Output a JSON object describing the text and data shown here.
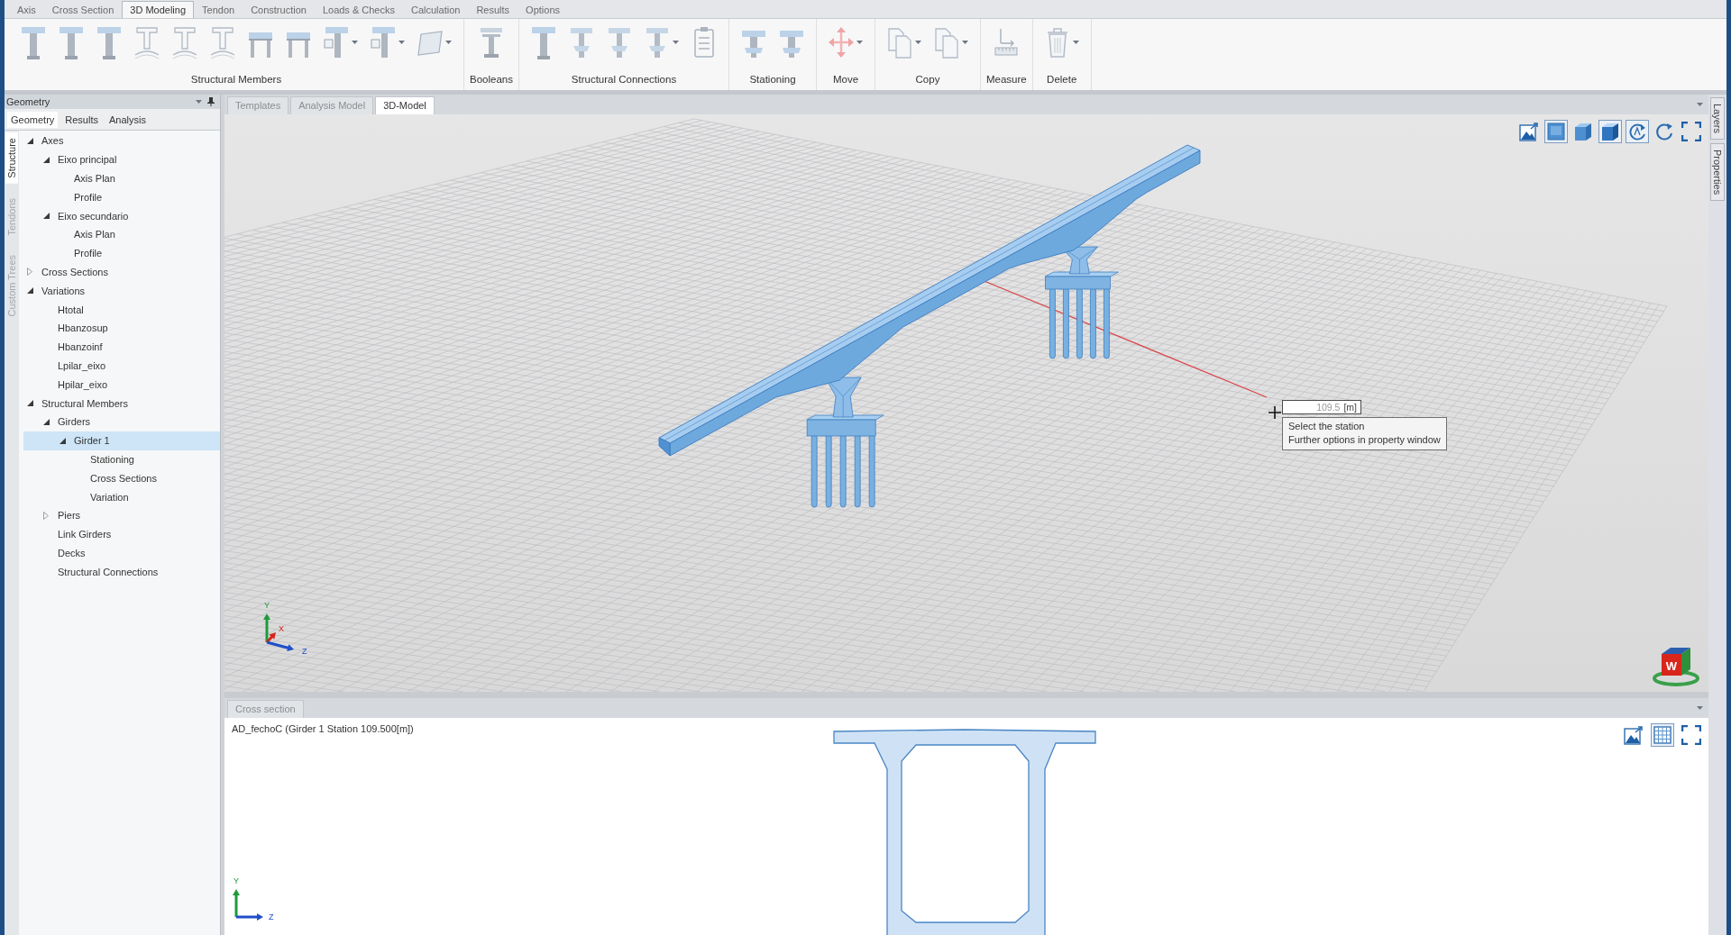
{
  "menu_tabs": [
    {
      "label": "Axis",
      "selected": false
    },
    {
      "label": "Cross Section",
      "selected": false
    },
    {
      "label": "3D Modeling",
      "selected": true
    },
    {
      "label": "Tendon",
      "selected": false
    },
    {
      "label": "Construction",
      "selected": false
    },
    {
      "label": "Loads & Checks",
      "selected": false
    },
    {
      "label": "Calculation",
      "selected": false
    },
    {
      "label": "Results",
      "selected": false
    },
    {
      "label": "Options",
      "selected": false
    }
  ],
  "ribbon": {
    "groups": [
      {
        "label": "Structural Members",
        "tools": [
          {
            "kind": "beam",
            "dropdown": false
          },
          {
            "kind": "beam",
            "dropdown": false
          },
          {
            "kind": "beam",
            "dropdown": false
          },
          {
            "kind": "curved-beam",
            "dropdown": false
          },
          {
            "kind": "curved-beam",
            "dropdown": false
          },
          {
            "kind": "curved-beam",
            "dropdown": false
          },
          {
            "kind": "frame",
            "dropdown": false
          },
          {
            "kind": "frame",
            "dropdown": false
          },
          {
            "kind": "beam-box",
            "dropdown": true
          },
          {
            "kind": "beam-box",
            "dropdown": true
          },
          {
            "kind": "plane",
            "dropdown": true
          }
        ]
      },
      {
        "label": "Booleans",
        "tools": [
          {
            "kind": "boolean",
            "dropdown": false
          }
        ]
      },
      {
        "label": "Structural Connections",
        "tools": [
          {
            "kind": "beam",
            "dropdown": false
          },
          {
            "kind": "connection",
            "dropdown": false
          },
          {
            "kind": "connection",
            "dropdown": false
          },
          {
            "kind": "connection",
            "dropdown": true
          },
          {
            "kind": "checklist",
            "dropdown": false
          }
        ]
      },
      {
        "label": "Stationing",
        "tools": [
          {
            "kind": "station",
            "dropdown": false
          },
          {
            "kind": "station",
            "dropdown": false
          }
        ]
      },
      {
        "label": "Move",
        "tools": [
          {
            "kind": "move",
            "dropdown": true
          }
        ]
      },
      {
        "label": "Copy",
        "tools": [
          {
            "kind": "copy",
            "dropdown": true
          },
          {
            "kind": "copy",
            "dropdown": true
          }
        ]
      },
      {
        "label": "Measure",
        "tools": [
          {
            "kind": "measure",
            "dropdown": false
          }
        ]
      },
      {
        "label": "Delete",
        "tools": [
          {
            "kind": "delete",
            "dropdown": true
          }
        ]
      }
    ]
  },
  "left_panel": {
    "title": "Geometry",
    "tabs": [
      {
        "label": "Geometry",
        "selected": true
      },
      {
        "label": "Results",
        "selected": false
      },
      {
        "label": "Analysis",
        "selected": false
      }
    ],
    "side_tabs": [
      {
        "label": "Structure",
        "selected": true
      },
      {
        "label": "Tendons",
        "selected": false
      },
      {
        "label": "Custom Trees",
        "selected": false
      }
    ],
    "tree": [
      {
        "label": "Axes",
        "kind": "branch",
        "expanded": true,
        "selected": false,
        "children": [
          {
            "label": "Eixo principal",
            "kind": "branch",
            "expanded": true,
            "selected": false,
            "children": [
              {
                "label": "Axis Plan",
                "kind": "leaf",
                "selected": false
              },
              {
                "label": "Profile",
                "kind": "leaf",
                "selected": false
              }
            ]
          },
          {
            "label": "Eixo secundario",
            "kind": "branch",
            "expanded": true,
            "selected": false,
            "children": [
              {
                "label": "Axis Plan",
                "kind": "leaf",
                "selected": false
              },
              {
                "label": "Profile",
                "kind": "leaf",
                "selected": false
              }
            ]
          }
        ]
      },
      {
        "label": "Cross Sections",
        "kind": "branch",
        "expanded": false,
        "selected": false
      },
      {
        "label": "Variations",
        "kind": "branch",
        "expanded": true,
        "selected": false,
        "children": [
          {
            "label": "Htotal",
            "kind": "leaf",
            "selected": false
          },
          {
            "label": "Hbanzosup",
            "kind": "leaf",
            "selected": false
          },
          {
            "label": "Hbanzoinf",
            "kind": "leaf",
            "selected": false
          },
          {
            "label": "Lpilar_eixo",
            "kind": "leaf",
            "selected": false
          },
          {
            "label": "Hpilar_eixo",
            "kind": "leaf",
            "selected": false
          }
        ]
      },
      {
        "label": "Structural Members",
        "kind": "branch",
        "expanded": true,
        "selected": false,
        "children": [
          {
            "label": "Girders",
            "kind": "branch",
            "expanded": true,
            "selected": false,
            "children": [
              {
                "label": "Girder 1",
                "kind": "branch",
                "expanded": true,
                "selected": true,
                "children": [
                  {
                    "label": "Stationing",
                    "kind": "leaf",
                    "selected": false
                  },
                  {
                    "label": "Cross Sections",
                    "kind": "leaf",
                    "selected": false
                  },
                  {
                    "label": "Variation",
                    "kind": "leaf",
                    "selected": false
                  }
                ]
              }
            ]
          },
          {
            "label": "Piers",
            "kind": "branch",
            "expanded": false,
            "selected": false
          },
          {
            "label": "Link Girders",
            "kind": "leaf",
            "selected": false
          },
          {
            "label": "Decks",
            "kind": "leaf",
            "selected": false
          },
          {
            "label": "Structural Connections",
            "kind": "leaf",
            "selected": false
          }
        ]
      }
    ]
  },
  "document_tabs": [
    {
      "label": "Templates",
      "selected": false
    },
    {
      "label": "Analysis Model",
      "selected": false
    },
    {
      "label": "3D-Model",
      "selected": true
    }
  ],
  "viewport": {
    "tools": [
      {
        "kind": "export-image",
        "on": false
      },
      {
        "kind": "front-view",
        "on": true
      },
      {
        "kind": "solid-view",
        "on": false
      },
      {
        "kind": "shaded-view",
        "on": true
      },
      {
        "kind": "auto-rotate",
        "on": true
      },
      {
        "kind": "reset-view",
        "on": false
      },
      {
        "kind": "fullscreen",
        "on": false
      }
    ],
    "axes": [
      {
        "label": "Y",
        "color": "#1f9a3a"
      },
      {
        "label": "X",
        "color": "#d8261c"
      },
      {
        "label": "Z",
        "color": "#1f4fc8"
      }
    ],
    "station_input": {
      "value": "109.5",
      "unit": "[m]"
    },
    "tooltip": {
      "lines": [
        "Select the station",
        "Further options in property window"
      ]
    },
    "view_cube": {
      "label": "W"
    }
  },
  "cross_section_panel": {
    "tab": "Cross section",
    "title": "AD_fechoC (Girder 1 Station 109.500[m])",
    "tools": [
      {
        "kind": "export-image",
        "on": false
      },
      {
        "kind": "grid",
        "on": true
      },
      {
        "kind": "fullscreen",
        "on": false
      }
    ],
    "axes": [
      {
        "label": "Y",
        "color": "#1f9a3a"
      },
      {
        "label": "Z",
        "color": "#1f4fc8"
      }
    ]
  },
  "right_tabs": [
    {
      "label": "Layers",
      "selected": false
    },
    {
      "label": "Properties",
      "selected": false
    }
  ]
}
